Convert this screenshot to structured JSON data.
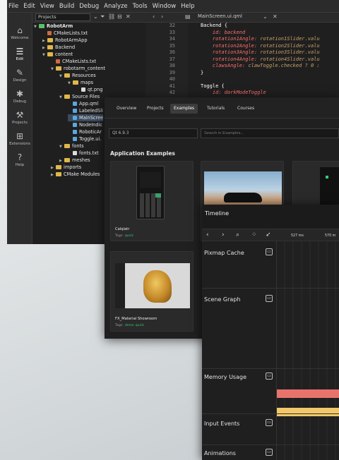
{
  "ide": {
    "menu": [
      "File",
      "Edit",
      "View",
      "Build",
      "Debug",
      "Analyze",
      "Tools",
      "Window",
      "Help"
    ],
    "modes": [
      {
        "label": "Welcome",
        "icon": "home-icon"
      },
      {
        "label": "Edit",
        "icon": "edit-icon"
      },
      {
        "label": "Design",
        "icon": "design-icon"
      },
      {
        "label": "Debug",
        "icon": "debug-icon"
      },
      {
        "label": "Projects",
        "icon": "projects-icon"
      },
      {
        "label": "Extensions",
        "icon": "extensions-icon"
      },
      {
        "label": "Help",
        "icon": "help-icon"
      }
    ],
    "projects_select": "Projects",
    "editor_tab": "MainScreen.ui.qml",
    "tree": [
      {
        "label": "RobotArm",
        "bold": true
      },
      {
        "label": "CMakeLists.txt"
      },
      {
        "label": "RobotArmApp"
      },
      {
        "label": "Backend"
      },
      {
        "label": "content"
      },
      {
        "label": "CMakeLists.txt"
      },
      {
        "label": "robotarm_content"
      },
      {
        "label": "Resources"
      },
      {
        "label": "maps"
      },
      {
        "label": "qt.png"
      },
      {
        "label": "Source Files"
      },
      {
        "label": "App.qml"
      },
      {
        "label": "LabeledSli"
      },
      {
        "label": "MainScree"
      },
      {
        "label": "NodeIndic"
      },
      {
        "label": "RoboticAr"
      },
      {
        "label": "Toggle.ui."
      },
      {
        "label": "fonts"
      },
      {
        "label": "fonts.txt"
      },
      {
        "label": "meshes"
      },
      {
        "label": "imports"
      },
      {
        "label": "CMake Modules"
      }
    ],
    "code": [
      {
        "ln": "32",
        "parts": [
          {
            "t": "Backend {",
            "c": "c-t"
          }
        ]
      },
      {
        "ln": "33",
        "parts": [
          {
            "t": "    id: ",
            "c": "c-id"
          },
          {
            "t": "backend",
            "c": "c-id"
          }
        ]
      },
      {
        "ln": "34",
        "parts": [
          {
            "t": "    rotation1Angle: ",
            "c": "c-id"
          },
          {
            "t": "rotation1Slider.valu",
            "c": "c-v"
          }
        ]
      },
      {
        "ln": "35",
        "parts": [
          {
            "t": "    rotation2Angle: ",
            "c": "c-id"
          },
          {
            "t": "rotation2Slider.valu",
            "c": "c-v"
          }
        ]
      },
      {
        "ln": "36",
        "parts": [
          {
            "t": "    rotation3Angle: ",
            "c": "c-id"
          },
          {
            "t": "rotation3Slider.valu",
            "c": "c-v"
          }
        ]
      },
      {
        "ln": "37",
        "parts": [
          {
            "t": "    rotation4Angle: ",
            "c": "c-id"
          },
          {
            "t": "rotation4Slider.valu",
            "c": "c-v"
          }
        ]
      },
      {
        "ln": "38",
        "parts": [
          {
            "t": "    clawsAngle: ",
            "c": "c-id"
          },
          {
            "t": "clawToggle.checked ? 0 : ",
            "c": "c-v"
          }
        ]
      },
      {
        "ln": "39",
        "parts": [
          {
            "t": "}",
            "c": "c-t"
          }
        ]
      },
      {
        "ln": "40",
        "parts": []
      },
      {
        "ln": "41",
        "parts": [
          {
            "t": "Toggle {",
            "c": "c-t"
          }
        ]
      },
      {
        "ln": "42",
        "parts": [
          {
            "t": "    id: ",
            "c": "c-id"
          },
          {
            "t": "darkModeToggle",
            "c": "c-id"
          }
        ]
      }
    ]
  },
  "welcome": {
    "tabs": [
      "Overview",
      "Projects",
      "Examples",
      "Tutorials",
      "Courses"
    ],
    "active_tab": 2,
    "qt_version": "Qt 6.9.3",
    "search_placeholder": "Search in Examples...",
    "section_title": "Application Examples",
    "cards": [
      {
        "title": "Calqlatr",
        "tags_label": "Tags:",
        "tags": [
          "quick"
        ]
      },
      {
        "title": "FX_Material Showroom",
        "tags_label": "Tags:",
        "tags": [
          "demo",
          "quick"
        ]
      }
    ]
  },
  "timeline": {
    "title": "Timeline",
    "ticks": [
      "527 ms",
      "570 m"
    ],
    "categories": [
      "Pixmap Cache",
      "Scene Graph",
      "Memory Usage",
      "Input Events",
      "Animations"
    ],
    "bar_colors": {
      "memory_top": "#e8736b",
      "memory_bottom": "#f2c86a"
    }
  }
}
